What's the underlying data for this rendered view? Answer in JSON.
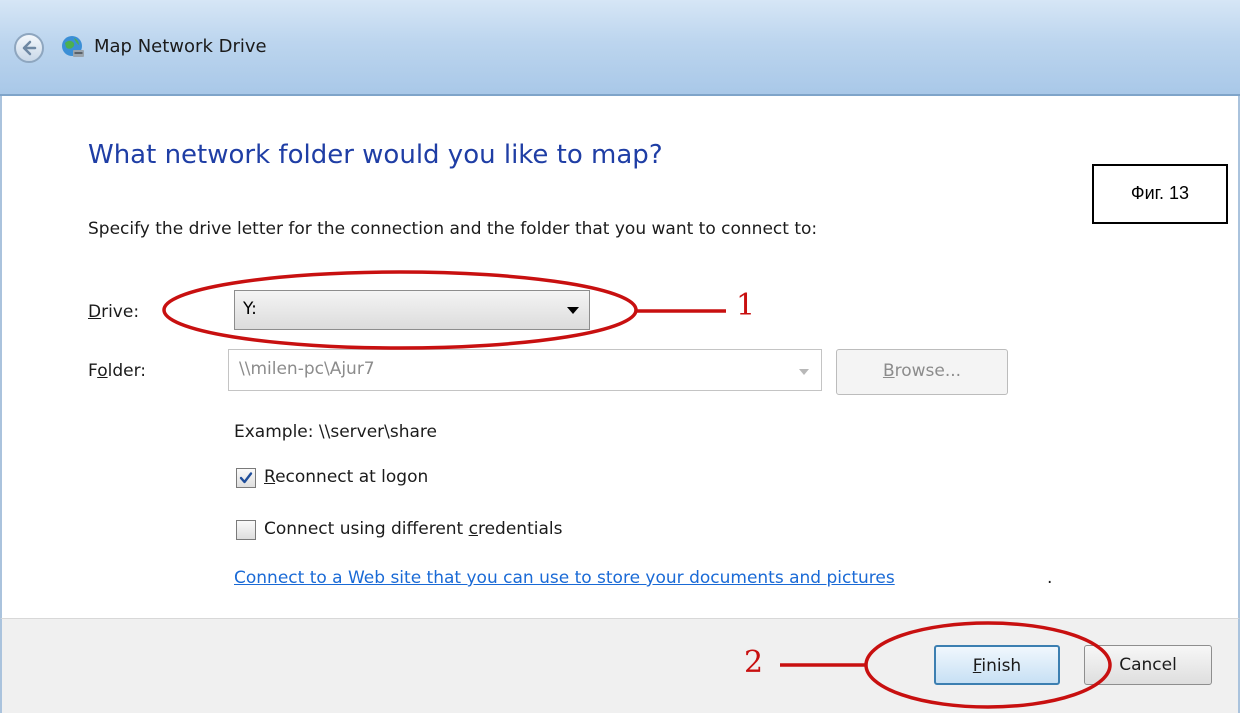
{
  "window": {
    "title": "Map Network Drive"
  },
  "header": {
    "heading": "What network folder would you like to map?",
    "instruction": "Specify the drive letter for the connection and the folder that you want to connect to:"
  },
  "figure_label": "Фиг. 13",
  "drive": {
    "label": "Drive:",
    "value": "Y:"
  },
  "folder": {
    "label": "Folder:",
    "value": "\\\\milen-pc\\Ajur7",
    "browse_label": "Browse..."
  },
  "example": "Example: \\\\server\\share",
  "options": {
    "reconnect": {
      "label": "Reconnect at logon",
      "checked": true
    },
    "credentials": {
      "label": "Connect using different credentials",
      "checked": false
    }
  },
  "link": {
    "text": "Connect to a Web site that you can use to store your documents and pictures",
    "suffix": "."
  },
  "footer": {
    "finish_label": "Finish",
    "cancel_label": "Cancel"
  },
  "annotations": {
    "marker_1": "1",
    "marker_2": "2",
    "color": "#c81010"
  }
}
